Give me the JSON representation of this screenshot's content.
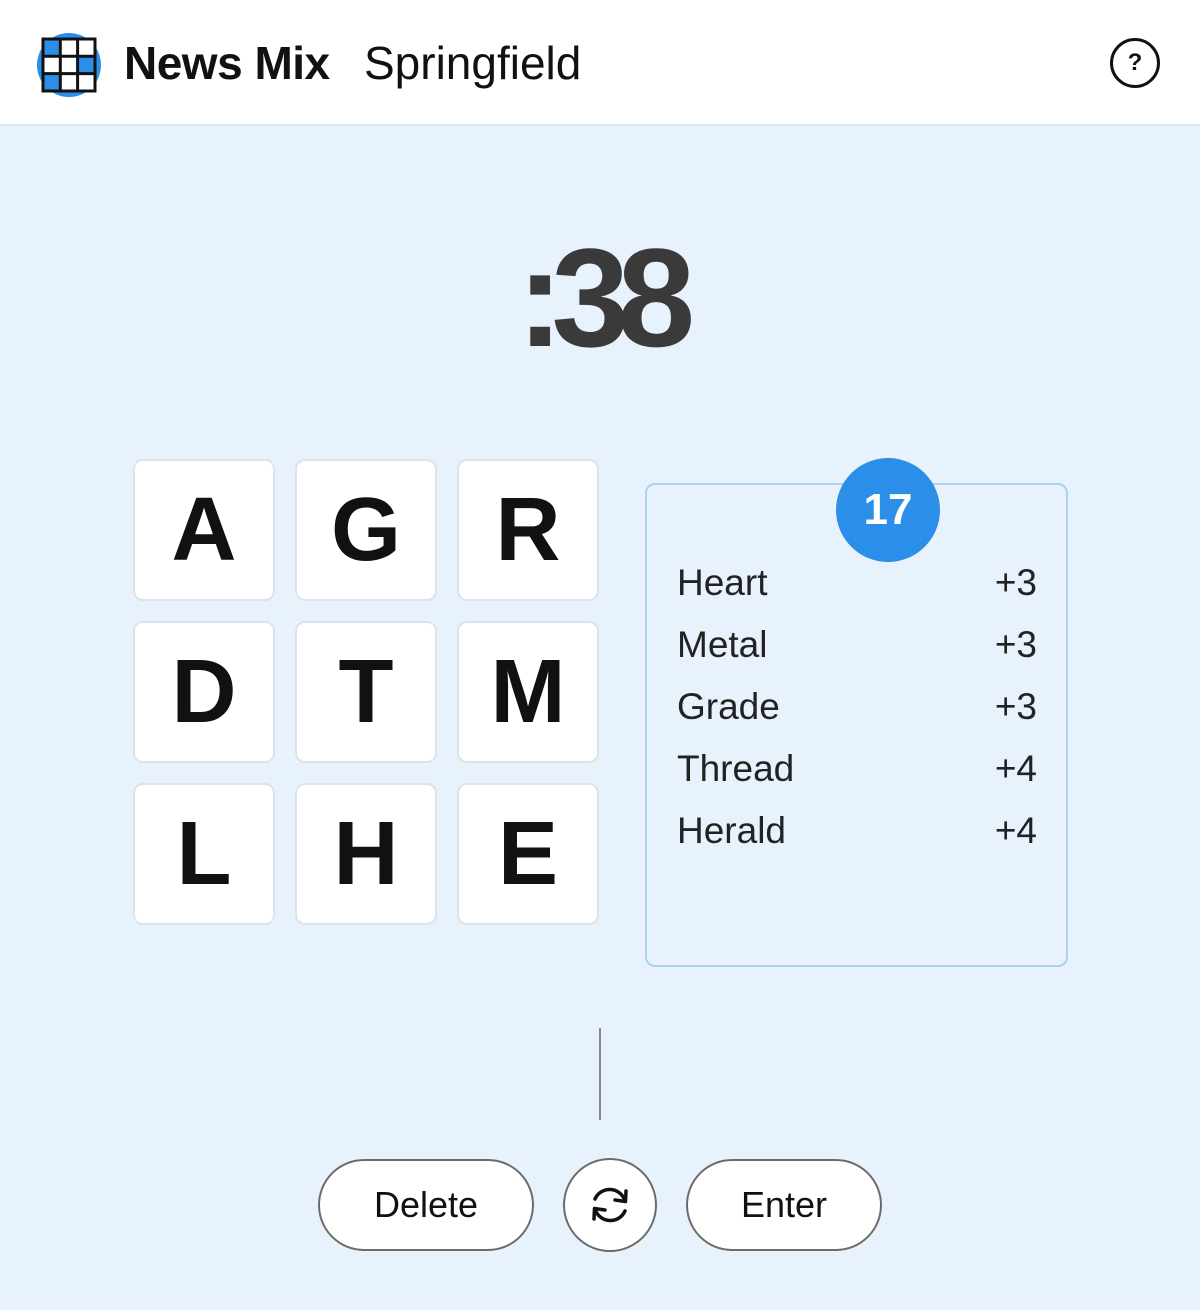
{
  "header": {
    "app_name": "News Mix",
    "city": "Springfield",
    "help_label": "?",
    "logo_icon": "grid-logo-icon",
    "brand_color": "#2b8ee8"
  },
  "timer": {
    "display": ":38"
  },
  "grid": {
    "tiles": [
      "A",
      "G",
      "R",
      "D",
      "T",
      "M",
      "L",
      "H",
      "E"
    ]
  },
  "score": {
    "total": "17",
    "badge_color": "#2b8ee8"
  },
  "found_words": [
    {
      "word": "Heart",
      "points": "+3"
    },
    {
      "word": "Metal",
      "points": "+3"
    },
    {
      "word": "Grade",
      "points": "+3"
    },
    {
      "word": "Thread",
      "points": "+4"
    },
    {
      "word": "Herald",
      "points": "+4"
    }
  ],
  "controls": {
    "delete_label": "Delete",
    "shuffle_icon": "shuffle-icon",
    "enter_label": "Enter"
  }
}
